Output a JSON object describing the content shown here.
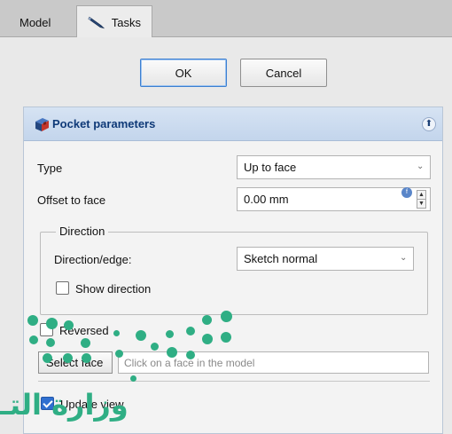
{
  "tabs": {
    "model": "Model",
    "tasks": "Tasks"
  },
  "buttons": {
    "ok": "OK",
    "cancel": "Cancel"
  },
  "pocket": {
    "title": "Pocket parameters",
    "type_label": "Type",
    "type_value": "Up to face",
    "offset_label": "Offset to face",
    "offset_value": "0.00 mm",
    "direction_group": "Direction",
    "direction_edge_label": "Direction/edge:",
    "direction_edge_value": "Sketch normal",
    "show_direction_label": "Show direction",
    "show_direction_checked": false,
    "reversed_label": "Reversed",
    "reversed_checked": false,
    "select_face_label": "Select face",
    "face_hint": "Click on a face in the model",
    "update_view_label": "Update view",
    "update_view_checked": true
  },
  "watermark": {
    "text": "وزارة التـ"
  },
  "colors": {
    "header_title": "#0f3a78",
    "header_bg": "#c9d9ee",
    "accent": "#2f6fd0",
    "watermark": "#2fae84"
  },
  "icons": {
    "tasks": "tasks-pencil-icon",
    "pocket": "pocket-feature-icon",
    "collapse": "collapse-up-icon",
    "dropdown": "chevron-down-icon",
    "expression": "expression-icon"
  }
}
